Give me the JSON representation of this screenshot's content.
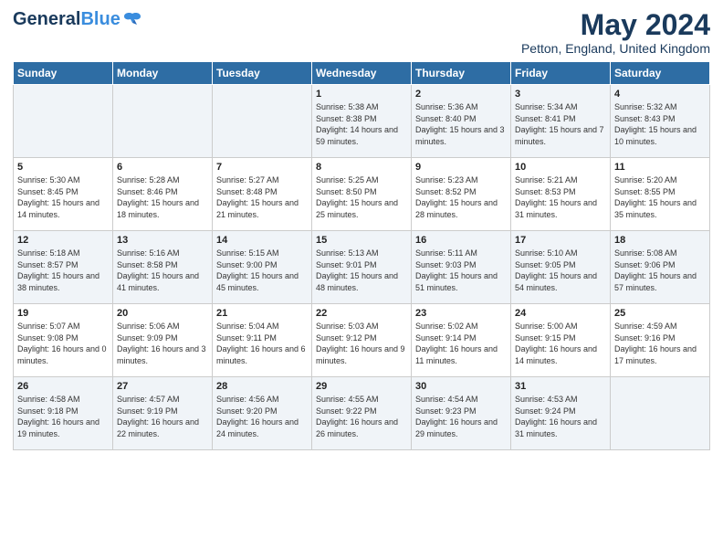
{
  "header": {
    "logo_general": "General",
    "logo_blue": "Blue",
    "title": "May 2024",
    "subtitle": "Petton, England, United Kingdom"
  },
  "days_of_week": [
    "Sunday",
    "Monday",
    "Tuesday",
    "Wednesday",
    "Thursday",
    "Friday",
    "Saturday"
  ],
  "weeks": [
    [
      {
        "day": "",
        "info": ""
      },
      {
        "day": "",
        "info": ""
      },
      {
        "day": "",
        "info": ""
      },
      {
        "day": "1",
        "info": "Sunrise: 5:38 AM\nSunset: 8:38 PM\nDaylight: 14 hours\nand 59 minutes."
      },
      {
        "day": "2",
        "info": "Sunrise: 5:36 AM\nSunset: 8:40 PM\nDaylight: 15 hours\nand 3 minutes."
      },
      {
        "day": "3",
        "info": "Sunrise: 5:34 AM\nSunset: 8:41 PM\nDaylight: 15 hours\nand 7 minutes."
      },
      {
        "day": "4",
        "info": "Sunrise: 5:32 AM\nSunset: 8:43 PM\nDaylight: 15 hours\nand 10 minutes."
      }
    ],
    [
      {
        "day": "5",
        "info": "Sunrise: 5:30 AM\nSunset: 8:45 PM\nDaylight: 15 hours\nand 14 minutes."
      },
      {
        "day": "6",
        "info": "Sunrise: 5:28 AM\nSunset: 8:46 PM\nDaylight: 15 hours\nand 18 minutes."
      },
      {
        "day": "7",
        "info": "Sunrise: 5:27 AM\nSunset: 8:48 PM\nDaylight: 15 hours\nand 21 minutes."
      },
      {
        "day": "8",
        "info": "Sunrise: 5:25 AM\nSunset: 8:50 PM\nDaylight: 15 hours\nand 25 minutes."
      },
      {
        "day": "9",
        "info": "Sunrise: 5:23 AM\nSunset: 8:52 PM\nDaylight: 15 hours\nand 28 minutes."
      },
      {
        "day": "10",
        "info": "Sunrise: 5:21 AM\nSunset: 8:53 PM\nDaylight: 15 hours\nand 31 minutes."
      },
      {
        "day": "11",
        "info": "Sunrise: 5:20 AM\nSunset: 8:55 PM\nDaylight: 15 hours\nand 35 minutes."
      }
    ],
    [
      {
        "day": "12",
        "info": "Sunrise: 5:18 AM\nSunset: 8:57 PM\nDaylight: 15 hours\nand 38 minutes."
      },
      {
        "day": "13",
        "info": "Sunrise: 5:16 AM\nSunset: 8:58 PM\nDaylight: 15 hours\nand 41 minutes."
      },
      {
        "day": "14",
        "info": "Sunrise: 5:15 AM\nSunset: 9:00 PM\nDaylight: 15 hours\nand 45 minutes."
      },
      {
        "day": "15",
        "info": "Sunrise: 5:13 AM\nSunset: 9:01 PM\nDaylight: 15 hours\nand 48 minutes."
      },
      {
        "day": "16",
        "info": "Sunrise: 5:11 AM\nSunset: 9:03 PM\nDaylight: 15 hours\nand 51 minutes."
      },
      {
        "day": "17",
        "info": "Sunrise: 5:10 AM\nSunset: 9:05 PM\nDaylight: 15 hours\nand 54 minutes."
      },
      {
        "day": "18",
        "info": "Sunrise: 5:08 AM\nSunset: 9:06 PM\nDaylight: 15 hours\nand 57 minutes."
      }
    ],
    [
      {
        "day": "19",
        "info": "Sunrise: 5:07 AM\nSunset: 9:08 PM\nDaylight: 16 hours\nand 0 minutes."
      },
      {
        "day": "20",
        "info": "Sunrise: 5:06 AM\nSunset: 9:09 PM\nDaylight: 16 hours\nand 3 minutes."
      },
      {
        "day": "21",
        "info": "Sunrise: 5:04 AM\nSunset: 9:11 PM\nDaylight: 16 hours\nand 6 minutes."
      },
      {
        "day": "22",
        "info": "Sunrise: 5:03 AM\nSunset: 9:12 PM\nDaylight: 16 hours\nand 9 minutes."
      },
      {
        "day": "23",
        "info": "Sunrise: 5:02 AM\nSunset: 9:14 PM\nDaylight: 16 hours\nand 11 minutes."
      },
      {
        "day": "24",
        "info": "Sunrise: 5:00 AM\nSunset: 9:15 PM\nDaylight: 16 hours\nand 14 minutes."
      },
      {
        "day": "25",
        "info": "Sunrise: 4:59 AM\nSunset: 9:16 PM\nDaylight: 16 hours\nand 17 minutes."
      }
    ],
    [
      {
        "day": "26",
        "info": "Sunrise: 4:58 AM\nSunset: 9:18 PM\nDaylight: 16 hours\nand 19 minutes."
      },
      {
        "day": "27",
        "info": "Sunrise: 4:57 AM\nSunset: 9:19 PM\nDaylight: 16 hours\nand 22 minutes."
      },
      {
        "day": "28",
        "info": "Sunrise: 4:56 AM\nSunset: 9:20 PM\nDaylight: 16 hours\nand 24 minutes."
      },
      {
        "day": "29",
        "info": "Sunrise: 4:55 AM\nSunset: 9:22 PM\nDaylight: 16 hours\nand 26 minutes."
      },
      {
        "day": "30",
        "info": "Sunrise: 4:54 AM\nSunset: 9:23 PM\nDaylight: 16 hours\nand 29 minutes."
      },
      {
        "day": "31",
        "info": "Sunrise: 4:53 AM\nSunset: 9:24 PM\nDaylight: 16 hours\nand 31 minutes."
      },
      {
        "day": "",
        "info": ""
      }
    ]
  ]
}
